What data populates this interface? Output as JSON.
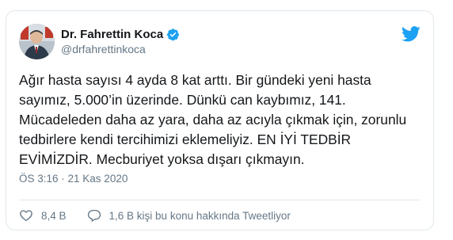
{
  "author": {
    "display_name": "Dr. Fahrettin Koca",
    "handle": "@drfahrettinkoca",
    "verified": true,
    "avatar_icon": "profile-photo-avatar"
  },
  "brand": {
    "icon": "twitter-bird-icon",
    "color": "#1da1f2"
  },
  "tweet": {
    "text": "Ağır hasta sayısı 4 ayda 8 kat arttı. Bir gündeki yeni hasta sayımız, 5.000’in üzerinde. Dünkü can kaybımız, 141. Mücadeleden daha az yara, daha az acıyla çıkmak için, zorunlu tedbirlere kendi tercihimizi eklemeliyiz. EN İYİ TEDBİR EVİMİZDİR. Mecburiyet yoksa dışarı çıkmayın.",
    "timestamp": "ÖS 3:16 · 21 Kas 2020"
  },
  "actions": {
    "likes": "8,4 B",
    "like_icon": "heart-icon",
    "conversation": "1,6 B kişi bu konu hakkında Tweetliyor",
    "conversation_icon": "comment-icon"
  },
  "colors": {
    "text": "#14171a",
    "secondary": "#657786",
    "border": "#e1e8ed",
    "verified": "#1da1f2"
  }
}
